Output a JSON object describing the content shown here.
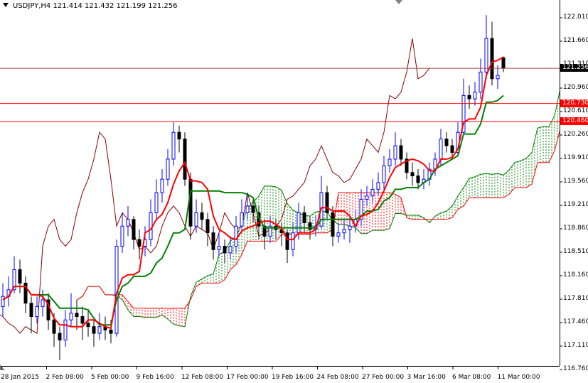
{
  "header": {
    "symbol": "USDJPY,H4",
    "open": "121.414",
    "high": "121.432",
    "low": "121.199",
    "close": "121.256"
  },
  "colors": {
    "bull": "#0000ff",
    "bear": "#000000",
    "tenkan": "#ff0000",
    "kijun": "#008000",
    "chikou": "#8b0000",
    "cloud_up": "#008000",
    "cloud_down": "#ff0000",
    "hline": "#ff0000",
    "price_line": "#808080"
  },
  "chart_data": {
    "type": "candlestick",
    "title": "USDJPY,H4",
    "ylim": [
      116.76,
      122.01
    ],
    "y_ticks": [
      "122.010",
      "121.660",
      "121.310",
      "120.960",
      "120.610",
      "120.260",
      "119.910",
      "119.560",
      "119.210",
      "118.860",
      "118.510",
      "118.160",
      "117.810",
      "117.460",
      "117.110",
      "116.760"
    ],
    "x_ticks": [
      "28 Jan 2015",
      "2 Feb 08:00",
      "5 Feb 00:00",
      "9 Feb 16:00",
      "12 Feb 08:00",
      "17 Feb 00:00",
      "19 Feb 16:00",
      "24 Feb 08:00",
      "27 Feb 00:00",
      "3 Mar 16:00",
      "6 Mar 08:00",
      "11 Mar 00:00"
    ],
    "price_tag": "121.256",
    "hlines": [
      {
        "value": 120.73,
        "label": "120.730"
      },
      {
        "value": 120.46,
        "label": "120.460"
      }
    ],
    "indicator": {
      "name": "Ichimoku",
      "tenkan": 5,
      "kijun": 13,
      "senkou_b": 26,
      "shift": 13
    },
    "candles": [
      [
        117.7,
        118.05,
        117.55,
        117.85
      ],
      [
        117.85,
        118.15,
        117.7,
        117.95
      ],
      [
        117.95,
        118.45,
        117.9,
        118.25
      ],
      [
        118.25,
        118.4,
        117.9,
        118.05
      ],
      [
        118.05,
        118.15,
        117.6,
        117.75
      ],
      [
        117.75,
        117.85,
        117.3,
        117.55
      ],
      [
        117.55,
        117.85,
        117.45,
        117.7
      ],
      [
        117.7,
        117.95,
        117.55,
        117.8
      ],
      [
        117.8,
        117.9,
        117.35,
        117.5
      ],
      [
        117.5,
        117.6,
        117.1,
        117.3
      ],
      [
        117.3,
        117.4,
        116.9,
        117.2
      ],
      [
        117.2,
        117.65,
        117.1,
        117.5
      ],
      [
        117.5,
        117.9,
        117.4,
        117.6
      ],
      [
        117.6,
        117.8,
        117.35,
        117.55
      ],
      [
        117.55,
        117.7,
        117.2,
        117.45
      ],
      [
        117.45,
        117.65,
        117.25,
        117.4
      ],
      [
        117.4,
        117.5,
        117.1,
        117.3
      ],
      [
        117.3,
        117.6,
        117.2,
        117.4
      ],
      [
        117.4,
        117.55,
        117.2,
        117.35
      ],
      [
        117.35,
        117.5,
        117.15,
        117.3
      ],
      [
        117.3,
        118.7,
        117.25,
        118.6
      ],
      [
        118.6,
        119.1,
        118.5,
        118.9
      ],
      [
        118.9,
        119.2,
        118.75,
        119.0
      ],
      [
        119.0,
        119.05,
        118.55,
        118.7
      ],
      [
        118.7,
        118.85,
        118.4,
        118.6
      ],
      [
        118.6,
        118.9,
        118.45,
        118.7
      ],
      [
        118.7,
        119.3,
        118.6,
        119.1
      ],
      [
        119.1,
        119.6,
        119.0,
        119.4
      ],
      [
        119.4,
        119.75,
        119.25,
        119.6
      ],
      [
        119.6,
        120.05,
        119.5,
        119.9
      ],
      [
        119.9,
        120.45,
        119.8,
        120.3
      ],
      [
        120.3,
        120.4,
        120.0,
        120.2
      ],
      [
        120.2,
        120.3,
        119.5,
        119.6
      ],
      [
        119.6,
        119.7,
        118.7,
        118.9
      ],
      [
        118.9,
        119.3,
        118.8,
        119.1
      ],
      [
        119.1,
        119.25,
        118.85,
        119.0
      ],
      [
        119.0,
        119.1,
        118.6,
        118.8
      ],
      [
        118.8,
        118.9,
        118.4,
        118.55
      ],
      [
        118.55,
        118.8,
        118.45,
        118.6
      ],
      [
        118.6,
        118.7,
        118.35,
        118.5
      ],
      [
        118.5,
        118.75,
        118.4,
        118.6
      ],
      [
        118.6,
        119.05,
        118.5,
        118.9
      ],
      [
        118.9,
        119.3,
        118.8,
        119.1
      ],
      [
        119.1,
        119.4,
        119.0,
        119.2
      ],
      [
        119.2,
        119.3,
        118.95,
        119.1
      ],
      [
        119.1,
        119.2,
        118.7,
        118.9
      ],
      [
        118.9,
        119.0,
        118.55,
        118.75
      ],
      [
        118.75,
        119.05,
        118.65,
        118.9
      ],
      [
        118.9,
        119.0,
        118.7,
        118.85
      ],
      [
        118.85,
        118.95,
        118.6,
        118.8
      ],
      [
        118.8,
        118.85,
        118.35,
        118.55
      ],
      [
        118.55,
        118.95,
        118.45,
        118.8
      ],
      [
        118.8,
        119.25,
        118.7,
        119.1
      ],
      [
        119.1,
        119.2,
        118.8,
        118.95
      ],
      [
        118.95,
        119.05,
        118.7,
        118.85
      ],
      [
        118.85,
        119.05,
        118.75,
        118.9
      ],
      [
        118.9,
        119.65,
        118.85,
        119.4
      ],
      [
        119.4,
        119.5,
        119.0,
        119.1
      ],
      [
        119.1,
        119.2,
        118.6,
        118.75
      ],
      [
        118.75,
        118.95,
        118.65,
        118.8
      ],
      [
        118.8,
        119.0,
        118.7,
        118.85
      ],
      [
        118.85,
        119.05,
        118.65,
        118.9
      ],
      [
        118.9,
        119.15,
        118.8,
        119.0
      ],
      [
        119.0,
        119.45,
        118.9,
        119.3
      ],
      [
        119.3,
        119.5,
        119.2,
        119.35
      ],
      [
        119.35,
        119.6,
        119.25,
        119.45
      ],
      [
        119.45,
        119.7,
        119.35,
        119.55
      ],
      [
        119.55,
        119.95,
        119.45,
        119.8
      ],
      [
        119.8,
        120.05,
        119.7,
        119.9
      ],
      [
        119.9,
        120.3,
        119.8,
        120.1
      ],
      [
        120.1,
        120.2,
        119.8,
        119.9
      ],
      [
        119.9,
        120.0,
        119.6,
        119.7
      ],
      [
        119.7,
        119.85,
        119.5,
        119.65
      ],
      [
        119.65,
        119.75,
        119.45,
        119.55
      ],
      [
        119.55,
        119.75,
        119.45,
        119.6
      ],
      [
        119.6,
        119.85,
        119.5,
        119.75
      ],
      [
        119.75,
        120.0,
        119.65,
        119.9
      ],
      [
        119.9,
        120.35,
        119.8,
        120.2
      ],
      [
        120.2,
        120.3,
        120.0,
        120.1
      ],
      [
        120.1,
        120.2,
        119.9,
        120.0
      ],
      [
        120.0,
        120.45,
        119.95,
        120.3
      ],
      [
        120.3,
        121.1,
        120.25,
        120.85
      ],
      [
        120.85,
        121.0,
        120.65,
        120.8
      ],
      [
        120.8,
        121.05,
        120.7,
        120.9
      ],
      [
        120.9,
        121.4,
        120.8,
        121.2
      ],
      [
        121.2,
        122.05,
        121.1,
        121.7
      ],
      [
        121.7,
        121.95,
        121.0,
        121.1
      ],
      [
        121.1,
        121.3,
        120.95,
        121.15
      ],
      [
        121.414,
        121.432,
        121.199,
        121.256
      ]
    ]
  }
}
